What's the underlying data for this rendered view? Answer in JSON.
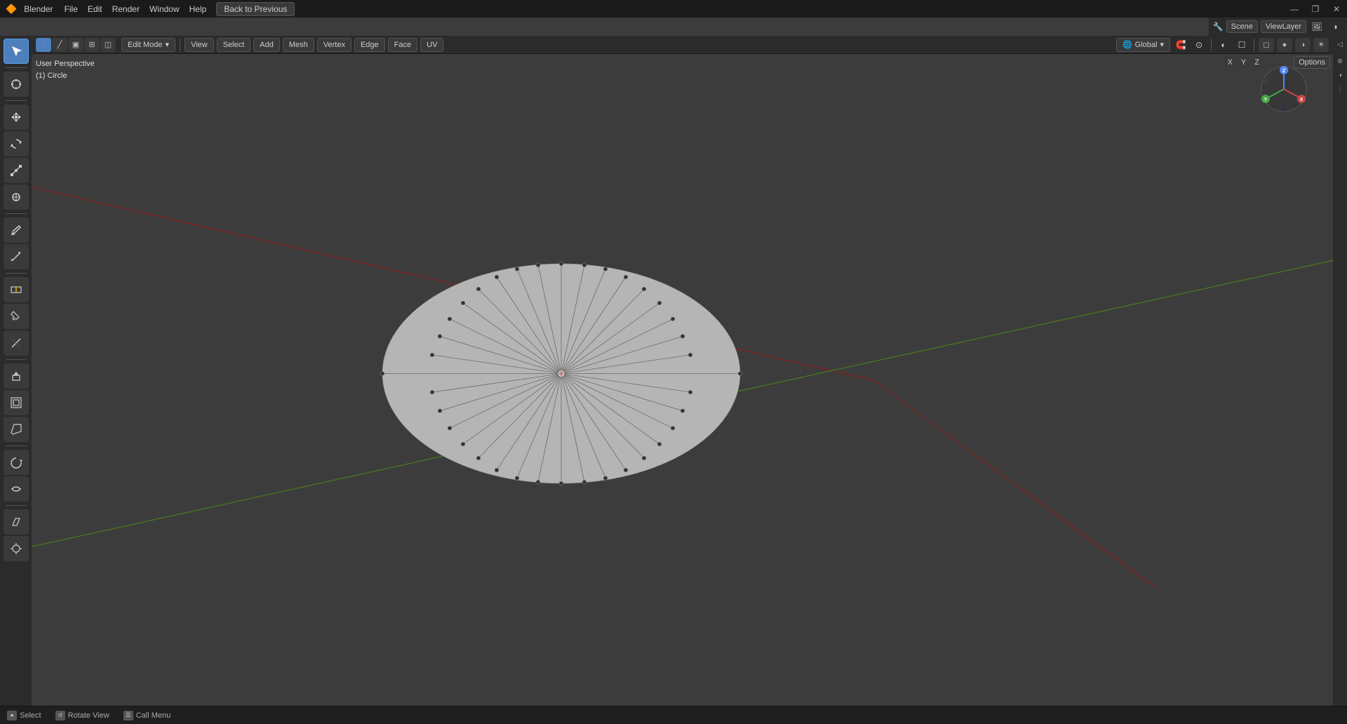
{
  "app": {
    "title": "Blender",
    "logo": "🔶"
  },
  "titlebar": {
    "menus": [
      "File",
      "Edit",
      "Render",
      "Window",
      "Help"
    ],
    "back_button": "Back to Previous",
    "win_controls": [
      "—",
      "❐",
      "✕"
    ]
  },
  "viewport_header": {
    "mode_dropdown": "Edit Mode",
    "transform_orientation": "Global",
    "menus": [
      "View",
      "Select",
      "Add",
      "Mesh",
      "Vertex",
      "Edge",
      "Face",
      "UV"
    ]
  },
  "view_info": {
    "line1": "User Perspective",
    "line2": "(1) Circle"
  },
  "statusbar": {
    "items": [
      {
        "icon": "●",
        "label": "Select"
      },
      {
        "icon": "↺",
        "label": "Rotate View"
      },
      {
        "icon": "☰",
        "label": "Call Menu"
      }
    ]
  },
  "topright": {
    "scene_label": "Scene",
    "viewlayer_label": "ViewLayer",
    "options_label": "Options"
  },
  "gizmo": {
    "x_label": "X",
    "y_label": "Y",
    "z_label": "Z"
  },
  "toolbar_tools": [
    {
      "icon": "↖",
      "name": "select",
      "active": true
    },
    {
      "icon": "⊕",
      "name": "cursor"
    },
    {
      "icon": "↕",
      "name": "move"
    },
    {
      "icon": "↻",
      "name": "rotate"
    },
    {
      "icon": "⤢",
      "name": "scale"
    },
    {
      "icon": "⊞",
      "name": "transform"
    },
    {
      "icon": "✏",
      "name": "annotate"
    },
    {
      "icon": "📐",
      "name": "measure"
    },
    {
      "icon": "⬡",
      "name": "poly-build"
    },
    {
      "icon": "⊡",
      "name": "loop-cut"
    },
    {
      "icon": "⋮",
      "name": "knife"
    },
    {
      "icon": "⊚",
      "name": "bisect"
    },
    {
      "icon": "◈",
      "name": "extrude"
    },
    {
      "icon": "◫",
      "name": "inset"
    },
    {
      "icon": "◱",
      "name": "bevel"
    },
    {
      "icon": "⊓",
      "name": "bridge"
    },
    {
      "icon": "⌖",
      "name": "shear"
    },
    {
      "icon": "⊕",
      "name": "spin"
    },
    {
      "icon": "⧲",
      "name": "smooth"
    },
    {
      "icon": "⊞",
      "name": "shrink"
    }
  ]
}
